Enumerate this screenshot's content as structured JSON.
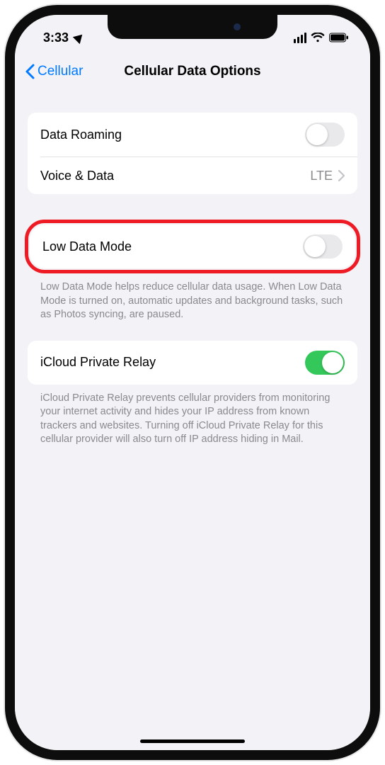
{
  "status": {
    "time": "3:33",
    "location_icon": "location-arrow-icon"
  },
  "nav": {
    "back_label": "Cellular",
    "title": "Cellular Data Options"
  },
  "group1": {
    "data_roaming_label": "Data Roaming",
    "data_roaming_on": false,
    "voice_data_label": "Voice & Data",
    "voice_data_value": "LTE"
  },
  "group2": {
    "low_data_label": "Low Data Mode",
    "low_data_on": false,
    "low_data_footer": "Low Data Mode helps reduce cellular data usage. When Low Data Mode is turned on, automatic updates and background tasks, such as Photos syncing, are paused."
  },
  "group3": {
    "private_relay_label": "iCloud Private Relay",
    "private_relay_on": true,
    "private_relay_footer": "iCloud Private Relay prevents cellular providers from monitoring your internet activity and hides your IP address from known trackers and websites. Turning off iCloud Private Relay for this cellular provider will also turn off IP address hiding in Mail."
  },
  "annotation": {
    "highlight_target": "low-data-mode-row",
    "highlight_color": "#ee1b24"
  }
}
